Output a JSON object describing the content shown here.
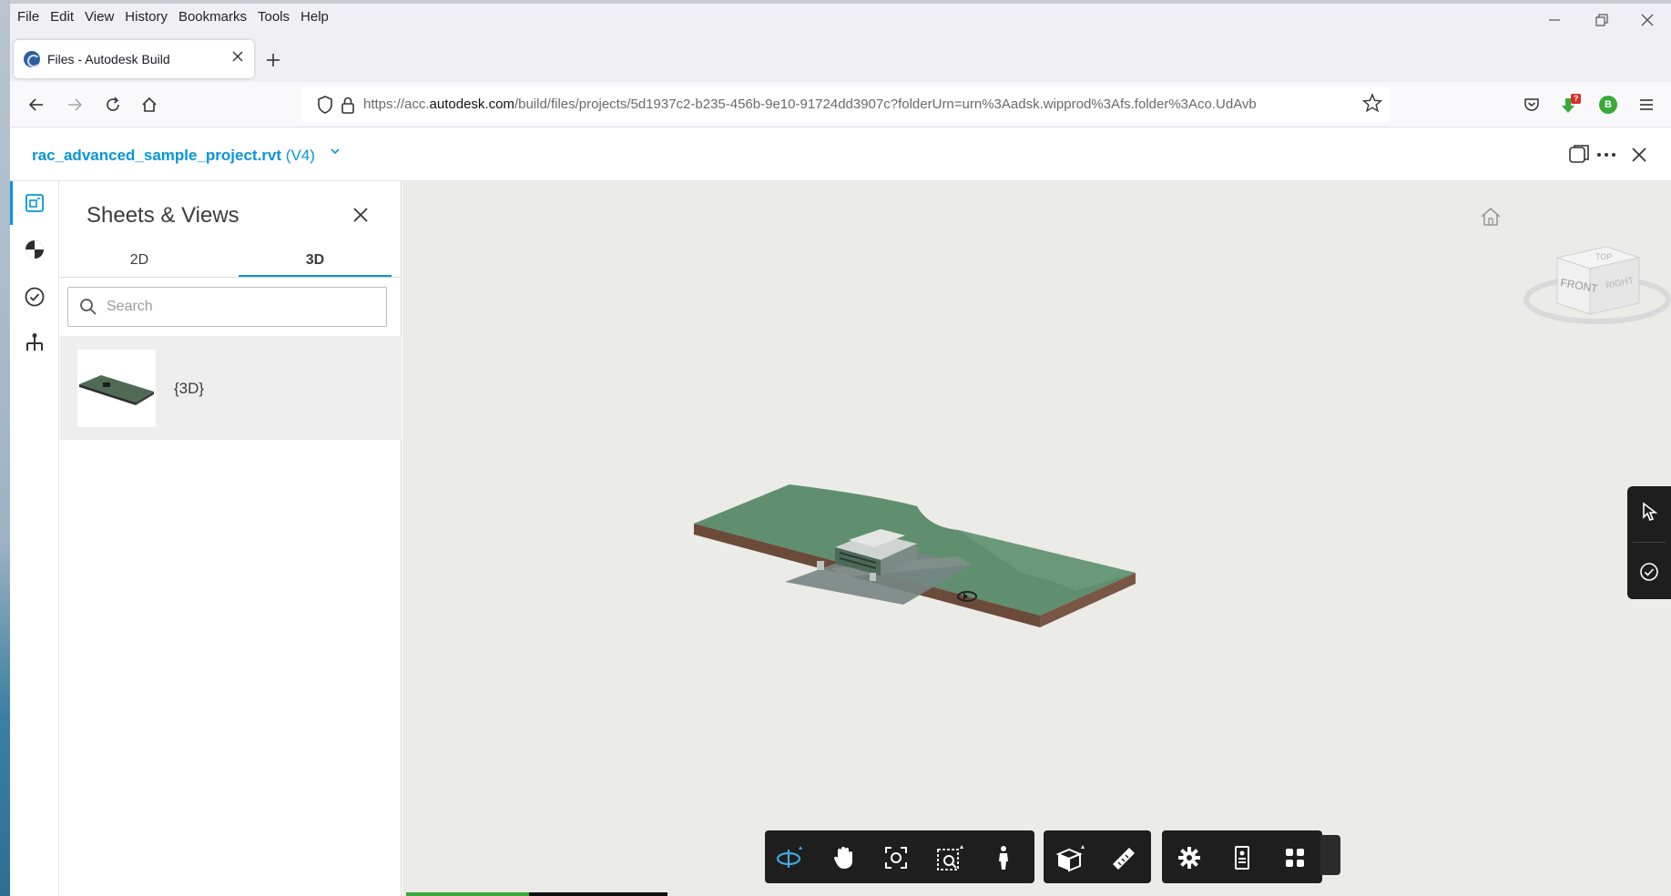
{
  "browser": {
    "menu": [
      {
        "label": "File"
      },
      {
        "label": "Edit"
      },
      {
        "label": "View"
      },
      {
        "label": "History"
      },
      {
        "label": "Bookmarks"
      },
      {
        "label": "Tools"
      },
      {
        "label": "Help"
      }
    ],
    "tab": {
      "title": "Files - Autodesk Build"
    },
    "url": {
      "prefix": "https://acc.",
      "domain": "autodesk.com",
      "path": "/build/files/projects/5d1937c2-b235-456b-9e10-91724dd3907c?folderUrn=urn%3Aadsk.wipprod%3Afs.folder%3Aco.UdAvb"
    },
    "extension_badge": "?",
    "profile_initial": "B"
  },
  "app": {
    "file_name": "rac_advanced_sample_project.rvt",
    "file_version": "(V4)"
  },
  "panel": {
    "title": "Sheets & Views",
    "tabs": [
      {
        "label": "2D"
      },
      {
        "label": "3D"
      }
    ],
    "active_tab": "3D",
    "search_placeholder": "Search",
    "items": [
      {
        "label": "{3D}"
      }
    ]
  },
  "viewer": {
    "viewcube_faces": [
      "TOP",
      "FRONT",
      "RIGHT"
    ],
    "loading_progress": 0.47
  },
  "colors": {
    "accent": "#0696d7",
    "toolbar_bg": "#1e1e1e",
    "progress": "#3ba83a",
    "terrain": "#5f8f6f"
  }
}
